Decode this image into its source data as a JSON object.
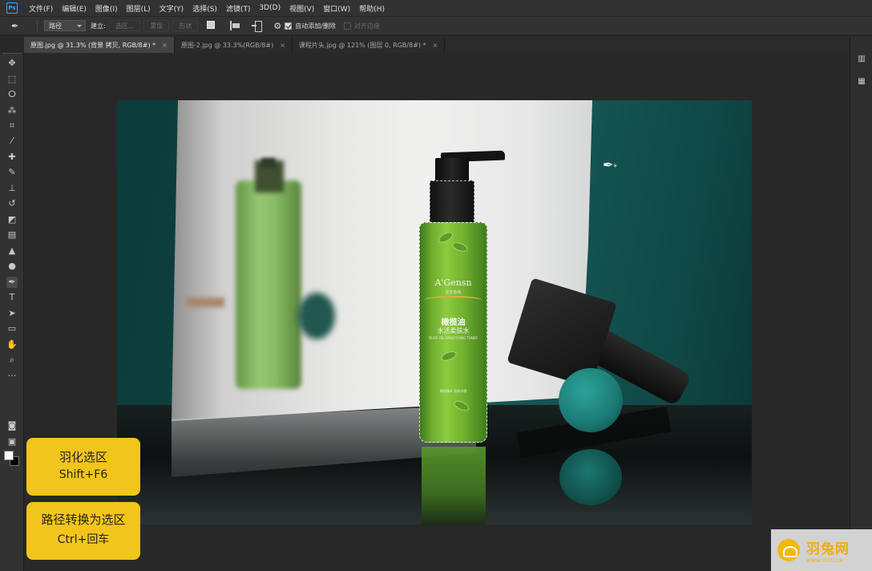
{
  "app": {
    "logo": "Ps"
  },
  "menu": [
    {
      "label": "文件(F)"
    },
    {
      "label": "编辑(E)"
    },
    {
      "label": "图像(I)"
    },
    {
      "label": "图层(L)"
    },
    {
      "label": "文字(Y)"
    },
    {
      "label": "选择(S)"
    },
    {
      "label": "滤镜(T)"
    },
    {
      "label": "3D(D)"
    },
    {
      "label": "视图(V)"
    },
    {
      "label": "窗口(W)"
    },
    {
      "label": "帮助(H)"
    }
  ],
  "options": {
    "tool_icon": "pen-tool-icon",
    "mode_select": "路径",
    "make_label": "建立:",
    "selection_btn": "选区...",
    "mask_btn": "蒙版",
    "shape_btn": "形状",
    "auto_add_delete": "自动添加/删除",
    "auto_add_delete_checked": true,
    "align_edges": "对齐边缘",
    "align_edges_checked": false
  },
  "tabs": [
    {
      "label": "原图.jpg @ 31.3% (背景 拷贝, RGB/8#) *",
      "active": true
    },
    {
      "label": "原图-2.jpg @ 33.3%(RGB/8#)",
      "active": false
    },
    {
      "label": "课程片头.jpg @ 121% (图层 0, RGB/8#) *",
      "active": false
    }
  ],
  "tools": [
    {
      "name": "move-tool",
      "glyph": "✥"
    },
    {
      "name": "marquee-tool",
      "glyph": "⬚"
    },
    {
      "name": "lasso-tool",
      "glyph": "ⵔ"
    },
    {
      "name": "magic-wand-tool",
      "glyph": "⁂"
    },
    {
      "name": "crop-tool",
      "glyph": "⌗"
    },
    {
      "name": "eyedropper-tool",
      "glyph": "⁄"
    },
    {
      "name": "healing-brush-tool",
      "glyph": "✚"
    },
    {
      "name": "brush-tool",
      "glyph": "✎"
    },
    {
      "name": "clone-stamp-tool",
      "glyph": "⊥"
    },
    {
      "name": "history-brush-tool",
      "glyph": "↺"
    },
    {
      "name": "eraser-tool",
      "glyph": "◩"
    },
    {
      "name": "gradient-tool",
      "glyph": "▤"
    },
    {
      "name": "blur-tool",
      "glyph": "▲"
    },
    {
      "name": "dodge-tool",
      "glyph": "●"
    },
    {
      "name": "pen-tool",
      "glyph": "✒",
      "active": true
    },
    {
      "name": "type-tool",
      "glyph": "T"
    },
    {
      "name": "path-selection-tool",
      "glyph": "➤"
    },
    {
      "name": "shape-tool",
      "glyph": "▭"
    },
    {
      "name": "hand-tool",
      "glyph": "✋"
    },
    {
      "name": "zoom-tool",
      "glyph": "⌕"
    },
    {
      "name": "more-tools",
      "glyph": "···"
    }
  ],
  "image": {
    "brand": "A'Gensn",
    "brand_sub": "安安金纯",
    "product_name": "橄榄油",
    "product_desc": "水活柔肤水",
    "product_en": "OLIVE OIL SMOOTHING TONER",
    "product_foot": "橄榄臻采 柔润水嫩"
  },
  "callouts": [
    {
      "line1": "羽化选区",
      "line2": "Shift+F6"
    },
    {
      "line1": "路径转换为选区",
      "line2": "Ctrl+回车"
    }
  ],
  "watermark": {
    "name": "羽兔网",
    "url": "WWW.YUTU.CN"
  }
}
